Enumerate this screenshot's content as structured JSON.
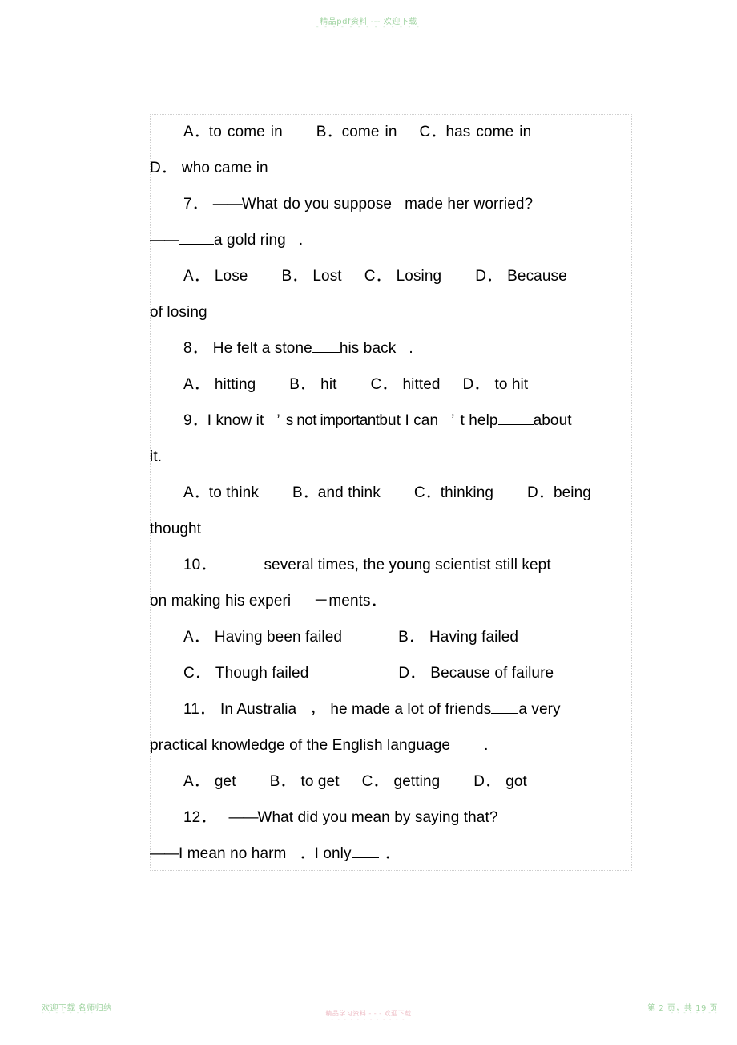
{
  "watermarks": {
    "top": "精品pdf资料 --- 欢迎下载",
    "top_sub": "- - - - - - - - - - - - -",
    "bottom_left": "欢迎下载  名师归纳",
    "bottom_left_sub": "-  -  -  -  -  -  -  -",
    "bottom_right": "第 2 页，共 19 页",
    "bottom_right_sub": "- - - - - - - -",
    "bottom_center": "精品学习资料 - - - 欢迎下载",
    "bottom_center_sub": "- - - - - - - - - - - -"
  },
  "document": {
    "lines": [
      {
        "id": "q6-options",
        "indent": true,
        "segments": [
          {
            "text": "A．to"
          },
          {
            "space": "sm"
          },
          {
            "text": "come"
          },
          {
            "space": "sm"
          },
          {
            "text": "in"
          },
          {
            "space": "xl"
          },
          {
            "text": "B．come"
          },
          {
            "space": "sm"
          },
          {
            "text": "in"
          },
          {
            "space": "lg"
          },
          {
            "text": "C．has"
          },
          {
            "space": "sm"
          },
          {
            "text": "come"
          },
          {
            "space": "sm"
          },
          {
            "text": "in"
          }
        ]
      },
      {
        "id": "q6-option-d",
        "indent": false,
        "segments": [
          {
            "text": "D．"
          },
          {
            "space": "sm"
          },
          {
            "text": "who came in"
          }
        ]
      },
      {
        "id": "q7-stem",
        "indent": true,
        "segments": [
          {
            "text": "7．"
          },
          {
            "space": "sm"
          },
          {
            "text": "——",
            "dash": true
          },
          {
            "text": "What"
          },
          {
            "space": "sm"
          },
          {
            "text": "do you suppose"
          },
          {
            "space": "md"
          },
          {
            "text": "made her worried?"
          }
        ]
      },
      {
        "id": "q7-answer",
        "indent": false,
        "segments": [
          {
            "text": "——",
            "dash": true
          },
          {
            "blank": "w5"
          },
          {
            "text": "a gold ring"
          },
          {
            "space": "md"
          },
          {
            "text": "."
          }
        ]
      },
      {
        "id": "q7-options",
        "indent": true,
        "segments": [
          {
            "text": "A．"
          },
          {
            "space": "sm"
          },
          {
            "text": "Lose"
          },
          {
            "space": "xl"
          },
          {
            "text": "B．"
          },
          {
            "space": "sm"
          },
          {
            "text": "Lost"
          },
          {
            "space": "lg"
          },
          {
            "text": "C．"
          },
          {
            "space": "sm"
          },
          {
            "text": "Losing"
          },
          {
            "space": "xl"
          },
          {
            "text": "D．"
          },
          {
            "space": "sm"
          },
          {
            "text": "Because"
          }
        ]
      },
      {
        "id": "q7-options-cont",
        "indent": false,
        "segments": [
          {
            "text": "of losing"
          }
        ]
      },
      {
        "id": "q8-stem",
        "indent": true,
        "segments": [
          {
            "text": "8．"
          },
          {
            "space": "sm"
          },
          {
            "text": "He felt a stone"
          },
          {
            "blank": "w4"
          },
          {
            "text": "his back"
          },
          {
            "space": "md"
          },
          {
            "text": "."
          }
        ]
      },
      {
        "id": "q8-options",
        "indent": true,
        "segments": [
          {
            "text": "A．"
          },
          {
            "space": "sm"
          },
          {
            "text": "hitting"
          },
          {
            "space": "xl"
          },
          {
            "text": "B．"
          },
          {
            "space": "sm"
          },
          {
            "text": "hit"
          },
          {
            "space": "xl"
          },
          {
            "text": "C．"
          },
          {
            "space": "sm"
          },
          {
            "text": "hitted"
          },
          {
            "space": "lg"
          },
          {
            "text": "D．"
          },
          {
            "space": "sm"
          },
          {
            "text": "to hit"
          }
        ]
      },
      {
        "id": "q9-stem",
        "indent": true,
        "bleed": true,
        "segments": [
          {
            "text": "9．I know it"
          },
          {
            "space": "md"
          },
          {
            "text": "’"
          },
          {
            "space": "sm"
          },
          {
            "text": "s not important",
            "tight": true
          },
          {
            "text": "but I can"
          },
          {
            "space": "md"
          },
          {
            "text": "’"
          },
          {
            "space": "sm"
          },
          {
            "text": "t help"
          },
          {
            "blank": "w5"
          },
          {
            "text": "about"
          }
        ]
      },
      {
        "id": "q9-stem-cont",
        "indent": false,
        "segments": [
          {
            "text": "it."
          }
        ]
      },
      {
        "id": "q9-options",
        "indent": true,
        "segments": [
          {
            "text": "A．to think"
          },
          {
            "space": "xl"
          },
          {
            "text": "B．and think"
          },
          {
            "space": "xl"
          },
          {
            "text": "C．thinking"
          },
          {
            "space": "xl"
          },
          {
            "text": "D．being"
          }
        ]
      },
      {
        "id": "q9-options-cont",
        "indent": false,
        "segments": [
          {
            "text": "thought"
          }
        ]
      },
      {
        "id": "q10-stem",
        "indent": true,
        "segments": [
          {
            "text": "10．"
          },
          {
            "space": "md"
          },
          {
            "blank": "w5"
          },
          {
            "text": "several times, the young scientist still kept"
          }
        ]
      },
      {
        "id": "q10-stem-cont",
        "indent": false,
        "segments": [
          {
            "text": "on making his experi"
          },
          {
            "space": "lg"
          },
          {
            "text": "－ments．"
          }
        ]
      },
      {
        "id": "q10-options-ab",
        "indent": true,
        "segments": [
          {
            "text": "A．"
          },
          {
            "space": "sm"
          },
          {
            "text": "Having been failed"
          },
          {
            "space": "xl"
          },
          {
            "space": "lg"
          },
          {
            "text": "B．"
          },
          {
            "space": "sm"
          },
          {
            "text": "Having failed"
          }
        ]
      },
      {
        "id": "q10-options-cd",
        "indent": true,
        "segments": [
          {
            "text": "C．"
          },
          {
            "space": "sm"
          },
          {
            "text": "Though failed"
          },
          {
            "space": "xl"
          },
          {
            "space": "xl"
          },
          {
            "space": "lg"
          },
          {
            "text": "D．"
          },
          {
            "space": "sm"
          },
          {
            "text": "Because of failure"
          }
        ]
      },
      {
        "id": "q11-stem",
        "indent": true,
        "segments": [
          {
            "text": "11．"
          },
          {
            "space": "sm"
          },
          {
            "text": "In Australia"
          },
          {
            "space": "md"
          },
          {
            "text": "，"
          },
          {
            "space": "sm"
          },
          {
            "text": "he made a lot of friends"
          },
          {
            "blank": "w4"
          },
          {
            "text": "a very"
          }
        ]
      },
      {
        "id": "q11-stem-cont",
        "indent": false,
        "segments": [
          {
            "text": "practical knowledge of the English language"
          },
          {
            "space": "xl"
          },
          {
            "text": "."
          }
        ]
      },
      {
        "id": "q11-options",
        "indent": true,
        "segments": [
          {
            "text": "A．"
          },
          {
            "space": "sm"
          },
          {
            "text": "get"
          },
          {
            "space": "xl"
          },
          {
            "text": "B．"
          },
          {
            "space": "sm"
          },
          {
            "text": "to get"
          },
          {
            "space": "lg"
          },
          {
            "text": "C．"
          },
          {
            "space": "sm"
          },
          {
            "text": "getting"
          },
          {
            "space": "xl"
          },
          {
            "text": "D．"
          },
          {
            "space": "sm"
          },
          {
            "text": "got"
          }
        ]
      },
      {
        "id": "q12-stem",
        "indent": true,
        "segments": [
          {
            "text": "12．"
          },
          {
            "space": "md"
          },
          {
            "text": "——",
            "dash": true
          },
          {
            "text": "What did you mean by saying that?"
          }
        ]
      },
      {
        "id": "q12-answer",
        "indent": false,
        "segments": [
          {
            "text": "——",
            "dash": true
          },
          {
            "text": "I mean no harm"
          },
          {
            "space": "md"
          },
          {
            "text": "．I only"
          },
          {
            "blank": "w4"
          },
          {
            "space": "sm"
          },
          {
            "text": "．"
          }
        ]
      }
    ]
  }
}
